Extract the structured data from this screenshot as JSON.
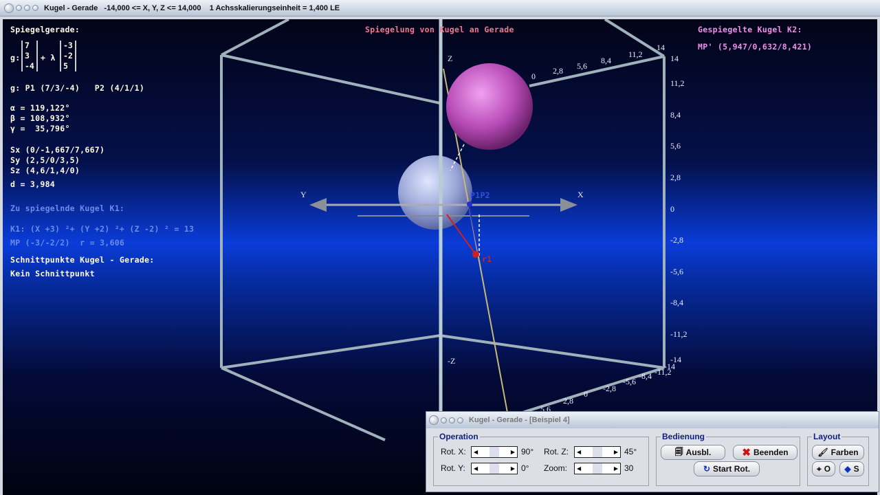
{
  "window": {
    "title": "Kugel - Gerade   -14,000 <= X, Y, Z <= 14,000    1 Achsskalierungseinheit = 1,400 LE"
  },
  "left": {
    "heading": "Spiegelgerade:",
    "g_label": "g:",
    "vec1": [
      "7",
      "3",
      "-4"
    ],
    "plus_lambda": "+ λ",
    "vec2": [
      "-3",
      "-2",
      "5"
    ],
    "points": "g: P1 (7/3/-4)   P2 (4/1/1)",
    "alpha": "α = 119,122°",
    "beta": "β = 108,932°",
    "gamma": "γ =  35,796°",
    "sx": "Sx (0/-1,667/7,667)",
    "sy": "Sy (2,5/0/3,5)",
    "sz": "Sz (4,6/1,4/0)",
    "d": "d = 3,984",
    "k1_heading": "Zu spiegelnde Kugel K1:",
    "k1_eq": "K1: (X +3) ²+ (Y +2) ²+ (Z -2) ² = 13",
    "k1_mp": "MP (-3/-2/2)  r = 3,606",
    "cut_heading": "Schnittpunkte Kugel - Gerade:",
    "cut_result": "Kein Schnittpunkt"
  },
  "center_title": "Spiegelung von Kugel an Gerade",
  "right": {
    "heading": "Gespiegelte Kugel K2:",
    "mp": "MP' (5,947/0,632/8,421)"
  },
  "axes": {
    "x": "X",
    "y": "Y",
    "z": "Z",
    "neg_z": "-Z",
    "p1p2": "P1P2",
    "r1": "r1",
    "z_ticks": [
      "14",
      "11,2",
      "8,4",
      "5,6",
      "2,8",
      "0",
      "-2,8",
      "-5,6",
      "-8,4",
      "-11,2",
      "-14"
    ],
    "top_ticks": [
      "0",
      "2,8",
      "5,6",
      "8,4",
      "11,2",
      "14"
    ],
    "bottom_ticks": [
      "-14",
      "-11,2",
      "-8,4",
      "-5,6",
      "-2,8",
      "0",
      "2,8",
      "5,6"
    ]
  },
  "colors": {
    "sphere_k1": "#a8b4e0",
    "sphere_k2": "#c050c0",
    "line": "#c8b878",
    "accent": "#102080"
  },
  "control": {
    "title": "Kugel - Gerade - [Beispiel 4]",
    "operation": {
      "label": "Operation",
      "rot_x": "Rot. X:",
      "rot_x_val": "90°",
      "rot_y": "Rot. Y:",
      "rot_y_val": "0°",
      "rot_z": "Rot. Z:",
      "rot_z_val": "45°",
      "zoom": "Zoom:",
      "zoom_val": "30"
    },
    "bedienung": {
      "label": "Bedienung",
      "ausbl": "Ausbl.",
      "beenden": "Beenden",
      "start_rot": "Start Rot."
    },
    "layout": {
      "label": "Layout",
      "farben": "Farben",
      "o": "O",
      "s": "S"
    }
  }
}
